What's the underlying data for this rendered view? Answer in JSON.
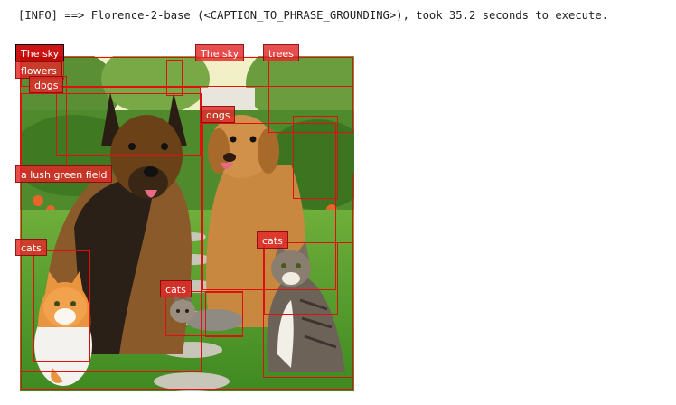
{
  "log": {
    "message": "[INFO] ==> Florence-2-base (<CAPTION_TO_PHRASE_GROUNDING>), took 35.2 seconds to execute."
  },
  "image": {
    "description_icon": "photo-garden-dogs-cats"
  },
  "labels": {
    "sky_1": "The sky",
    "sky_2": "The sky",
    "trees": "trees",
    "flowers": "flowers",
    "dogs_1": "dogs",
    "dogs_2": "dogs",
    "field": "a lush green field",
    "cats_1": "cats",
    "cats_2": "cats",
    "cats_3": "cats"
  },
  "colors": {
    "box_stroke": "#e01010",
    "label_fill": "#e22828",
    "label_text": "#ffffff"
  }
}
